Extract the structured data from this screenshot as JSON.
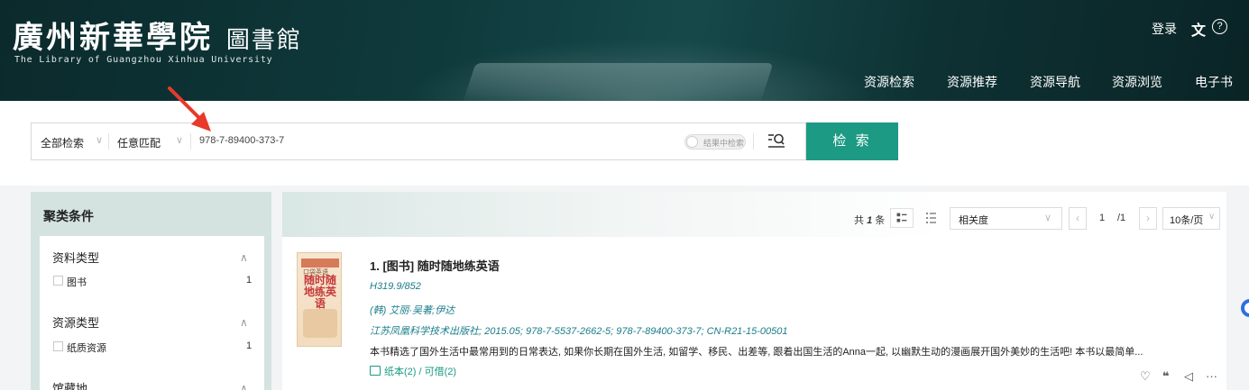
{
  "header": {
    "logo_cn": "廣州新華學院",
    "logo_cn_sub": "圖書館",
    "logo_en": "The Library of Guangzhou Xinhua University",
    "login": "登录",
    "lang_icon": "文",
    "help_icon": "?",
    "nav": [
      "资源检索",
      "资源推荐",
      "资源导航",
      "资源浏览",
      "电子书"
    ]
  },
  "search": {
    "scope": "全部检索",
    "match": "任意匹配",
    "query": "978-7-89400-373-7",
    "within_results": "结果中检索",
    "button": "检 索"
  },
  "facets": {
    "title": "聚类条件",
    "groups": [
      {
        "title": "资料类型",
        "items": [
          {
            "label": "图书",
            "count": "1"
          }
        ]
      },
      {
        "title": "资源类型",
        "items": [
          {
            "label": "纸质资源",
            "count": "1"
          }
        ]
      },
      {
        "title": "馆藏地",
        "items": []
      }
    ]
  },
  "results": {
    "total_prefix": "共",
    "total": "1",
    "total_suffix": "条",
    "sort": "相关度",
    "page_current": "1",
    "page_total": "/1",
    "per_page": "10条/页",
    "items": [
      {
        "cover_title": "随时随地练英语",
        "cover_top": "口袋英语",
        "title": "1. [图书] 随时随地练英语",
        "call_no": "H319.9/852",
        "authors": "(韩) 艾丽·吴著;伊达",
        "publication": "江苏凤凰科学技术出版社; 2015.05; 978-7-5537-2662-5; 978-7-89400-373-7; CN-R21-15-00501",
        "abstract": "本书精选了国外生活中最常用到的日常表达, 如果你长期在国外生活, 如留学、移民、出差等, 跟着出国生活的Anna一起, 以幽默生动的漫画展开国外美妙的生活吧! 本书以最简单...",
        "holdings": "纸本(2) / 可借(2)"
      }
    ],
    "actions": [
      "♡",
      "❝",
      "◁",
      "···"
    ]
  },
  "colors": {
    "accent": "#1c9a83",
    "header_bg": "#0f3a3c",
    "facet_bg": "#d5e3e0",
    "link": "#1a7e8a"
  }
}
